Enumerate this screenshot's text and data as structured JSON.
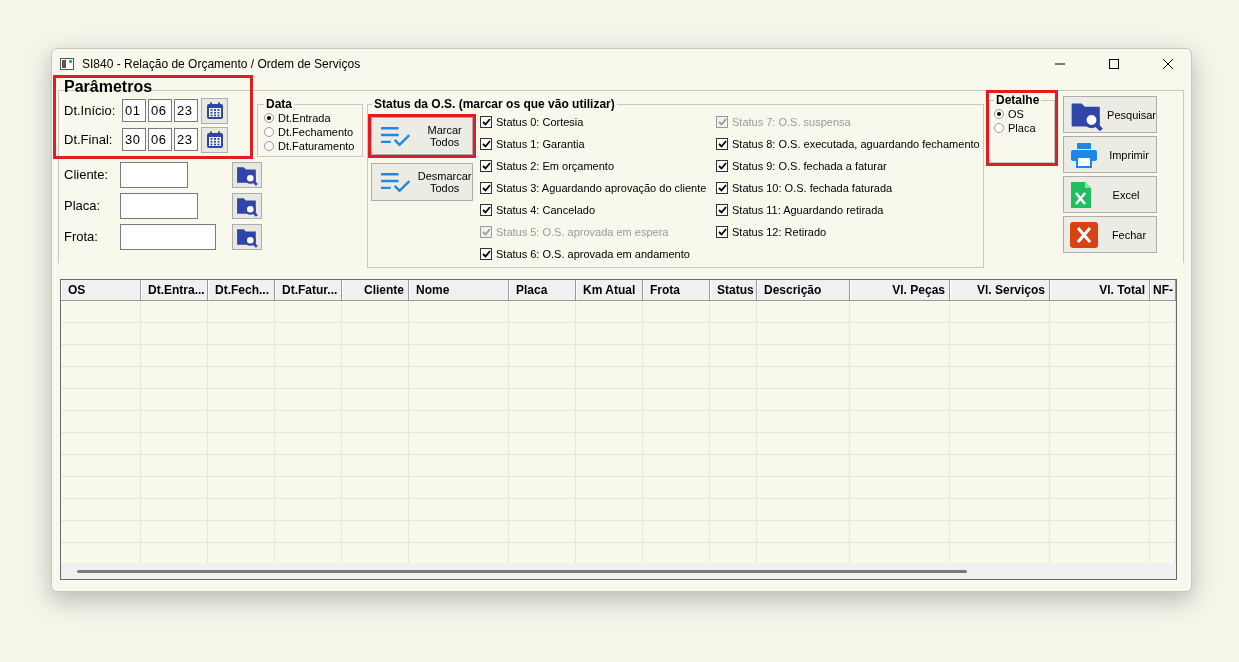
{
  "window": {
    "title": "SI840 - Relação de Orçamento / Ordem de Serviços"
  },
  "parameters": {
    "title": "Parâmetros",
    "highlighted": true,
    "date_rows": [
      {
        "label": "Dt.Início:",
        "day": "01",
        "month": "06",
        "year": "23"
      },
      {
        "label": "Dt.Final:",
        "day": "30",
        "month": "06",
        "year": "23"
      }
    ],
    "fields": [
      {
        "label": "Cliente:"
      },
      {
        "label": "Placa:"
      },
      {
        "label": "Frota:"
      }
    ]
  },
  "date_group": {
    "title": "Data",
    "options": [
      {
        "label": "Dt.Entrada",
        "selected": true
      },
      {
        "label": "Dt.Fechamento",
        "selected": false
      },
      {
        "label": "Dt.Faturamento",
        "selected": false
      }
    ]
  },
  "status_group": {
    "title": "Status da O.S. (marcar os que vão utilizar)",
    "buttons": [
      {
        "label": "Marcar Todos",
        "highlighted": true
      },
      {
        "label": "Desmarcar Todos",
        "highlighted": false
      }
    ],
    "statuses": [
      {
        "label": "Status 0: Cortesia",
        "checked": true,
        "disabled": false
      },
      {
        "label": "Status 1: Garantia",
        "checked": true,
        "disabled": false
      },
      {
        "label": "Status 2: Em orçamento",
        "checked": true,
        "disabled": false
      },
      {
        "label": "Status 3: Aguardando aprovação do cliente",
        "checked": true,
        "disabled": false
      },
      {
        "label": "Status 4: Cancelado",
        "checked": true,
        "disabled": false
      },
      {
        "label": "Status 5: O.S. aprovada em espera",
        "checked": true,
        "disabled": true
      },
      {
        "label": "Status 6: O.S. aprovada em andamento",
        "checked": true,
        "disabled": false
      },
      {
        "label": "Status 7: O.S. suspensa",
        "checked": true,
        "disabled": true
      },
      {
        "label": "Status 8: O.S. executada, aguardando fechamento",
        "checked": true,
        "disabled": false
      },
      {
        "label": "Status 9: O.S. fechada a faturar",
        "checked": true,
        "disabled": false
      },
      {
        "label": "Status 10: O.S. fechada faturada",
        "checked": true,
        "disabled": false
      },
      {
        "label": "Status 11: Aguardando retirada",
        "checked": true,
        "disabled": false
      },
      {
        "label": "Status 12: Retirado",
        "checked": true,
        "disabled": false
      }
    ]
  },
  "detail_group": {
    "title": "Detalhe",
    "highlighted": true,
    "options": [
      {
        "label": "OS",
        "selected": true
      },
      {
        "label": "Placa",
        "selected": false
      }
    ]
  },
  "actions": [
    {
      "label": "Pesquisar",
      "kind": "search"
    },
    {
      "label": "Imprimir",
      "kind": "print"
    },
    {
      "label": "Excel",
      "kind": "excel"
    },
    {
      "label": "Fechar",
      "kind": "close"
    }
  ],
  "table": {
    "columns": [
      {
        "label": "OS"
      },
      {
        "label": "Dt.Entra..."
      },
      {
        "label": "Dt.Fech..."
      },
      {
        "label": "Dt.Fatur..."
      },
      {
        "label": "Cliente"
      },
      {
        "label": "Nome"
      },
      {
        "label": "Placa"
      },
      {
        "label": "Km Atual"
      },
      {
        "label": "Frota"
      },
      {
        "label": "Status"
      },
      {
        "label": "Descrição"
      },
      {
        "label": "Vl. Peças"
      },
      {
        "label": "Vl. Serviços"
      },
      {
        "label": "Vl. Total"
      },
      {
        "label": "NF-"
      }
    ]
  }
}
